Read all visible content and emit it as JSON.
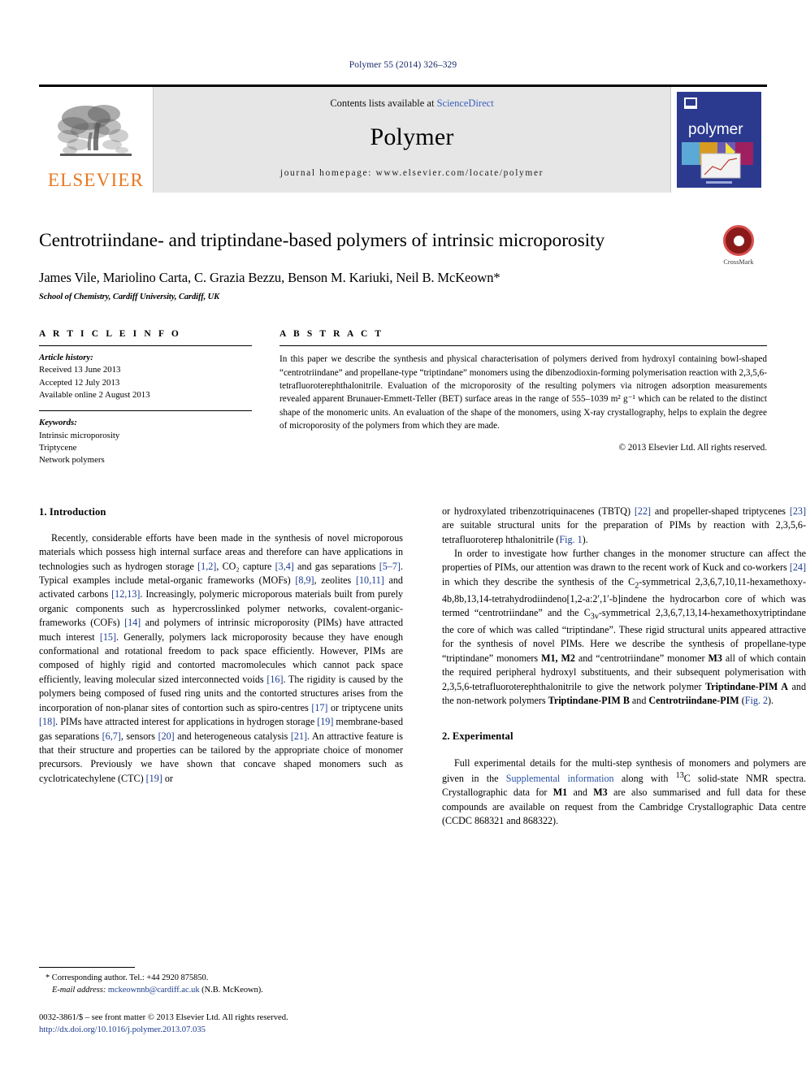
{
  "running_head": "Polymer 55 (2014) 326–329",
  "masthead": {
    "publisher_name": "ELSEVIER",
    "contents_prefix": "Contents lists available at ",
    "contents_link": "ScienceDirect",
    "journal_title": "Polymer",
    "homepage": "journal homepage: www.elsevier.com/locate/polymer",
    "cover_title": "polymer"
  },
  "article": {
    "title": "Centrotriindane- and triptindane-based polymers of intrinsic microporosity",
    "authors": "James Vile, Mariolino Carta, C. Grazia Bezzu, Benson M. Kariuki, Neil B. McKeown*",
    "affiliation": "School of Chemistry, Cardiff University, Cardiff, UK",
    "crossmark_label": "CrossMark"
  },
  "article_info": {
    "heading": "A R T I C L E    I N F O",
    "history_label": "Article history:",
    "history": [
      "Received 13 June 2013",
      "Accepted 12 July 2013",
      "Available online 2 August 2013"
    ],
    "keywords_label": "Keywords:",
    "keywords": [
      "Intrinsic microporosity",
      "Triptycene",
      "Network polymers"
    ]
  },
  "abstract": {
    "heading": "A B S T R A C T",
    "text": "In this paper we describe the synthesis and physical characterisation of polymers derived from hydroxyl containing bowl-shaped “centrotriindane” and propellane-type “triptindane” monomers using the dibenzodioxin-forming polymerisation reaction with 2,3,5,6-tetrafluoroterephthalonitrile. Evaluation of the microporosity of the resulting polymers via nitrogen adsorption measurements revealed apparent Brunauer-Emmett-Teller (BET) surface areas in the range of 555–1039 m² g⁻¹ which can be related to the distinct shape of the monomeric units. An evaluation of the shape of the monomers, using X-ray crystallography, helps to explain the degree of microporosity of the polymers from which they are made.",
    "copyright": "© 2013 Elsevier Ltd. All rights reserved."
  },
  "sections": {
    "introduction_heading": "1.  Introduction",
    "experimental_heading": "2.  Experimental"
  },
  "body": {
    "intro_p1_a": "Recently, considerable efforts have been made in the synthesis of novel microporous materials which possess high internal surface areas and therefore can have applications in technologies such as hydrogen storage ",
    "ref_1_2": "[1,2]",
    "intro_p1_b": ", CO₂ capture ",
    "ref_3_4": "[3,4]",
    "intro_p1_c": " and gas separations ",
    "ref_5_7": "[5–7]",
    "intro_p1_d": ". Typical examples include metal-organic frameworks (MOFs) ",
    "ref_8_9": "[8,9]",
    "intro_p1_e": ", zeolites ",
    "ref_10_11": "[10,11]",
    "intro_p1_f": " and activated carbons ",
    "ref_12_13": "[12,13]",
    "intro_p1_g": ". Increasingly, polymeric microporous materials built from purely organic components such as hypercrosslinked polymer networks, covalent-organic-frameworks (COFs) ",
    "ref_14": "[14]",
    "intro_p1_h": " and polymers of intrinsic microporosity (PIMs) have attracted much interest ",
    "ref_15": "[15]",
    "intro_p1_i": ". Generally, polymers lack microporosity because they have enough conformational and rotational freedom to pack space efficiently. However, PIMs are composed of highly rigid and contorted macromolecules which cannot pack space efficiently, leaving molecular sized interconnected voids ",
    "ref_16": "[16]",
    "intro_p1_j": ". The rigidity is caused by the polymers being composed of fused ring units and the contorted structures arises from the incorporation of non-planar sites of contortion such as spiro-centres ",
    "ref_17": "[17]",
    "intro_p1_k": " or triptycene units ",
    "ref_18": "[18]",
    "intro_p1_l": ". PIMs have attracted interest for applications in hydrogen storage ",
    "ref_19": "[19]",
    "intro_p1_m": " membrane-based gas separations ",
    "ref_6_7": "[6,7]",
    "intro_p1_n": ", sensors ",
    "ref_20": "[20]",
    "intro_p1_o": " and heterogeneous catalysis ",
    "ref_21": "[21]",
    "intro_p1_p": ". An attractive feature is that their structure and properties can be tailored by the appropriate choice of monomer precursors. Previously we have shown that concave shaped monomers such as cyclotricatechylene (CTC) ",
    "ref_19b": "[19]",
    "intro_p1_q": " or hydroxylated tribenzotriquinacenes (TBTQ) ",
    "ref_22": "[22]",
    "intro_p1_r": " and propeller-shaped triptycenes ",
    "ref_23": "[23]",
    "intro_p1_s": " are suitable structural units for the preparation of PIMs by reaction with 2,3,5,6-tetrafluoroterep hthalonitrile (",
    "fig1": "Fig. 1",
    "intro_p1_t": ").",
    "intro_p2_a": "In order to investigate how further changes in the monomer structure can affect the properties of PIMs, our attention was drawn to the recent work of Kuck and co-workers ",
    "ref_24": "[24]",
    "intro_p2_b": " in which they describe the synthesis of the C",
    "sub_2": "2",
    "intro_p2_c": "-symmetrical 2,3,6,7,10,11-hexamethoxy-4b,8b,13,14-tetrahydrodiindeno[1,2-a:2′,1′-b]indene the hydrocarbon core of which was termed “centrotriindane” and the C",
    "sub_3v": "3v",
    "intro_p2_d": "-symmetrical 2,3,6,7,13,14-hexamethoxytriptindane the core of which was called “triptindane”. These rigid structural units appeared attractive for the synthesis of novel PIMs. Here we describe the synthesis of propellane-type “triptindane” monomers ",
    "bold_m1m2": "M1, M2",
    "intro_p2_e": " and “centrotriindane” monomer ",
    "bold_m3": "M3",
    "intro_p2_f": " all of which contain the required peripheral hydroxyl substituents, and their subsequent polymerisation with 2,3,5,6-tetrafluoroterephthalonitrile to give the network polymer ",
    "bold_tpimA": "Triptindane-PIM A",
    "intro_p2_g": " and the non-network polymers ",
    "bold_tpimB": "Triptindane-PIM B",
    "intro_p2_h": " and ",
    "bold_cpim": "Centrotriindane-PIM",
    "intro_p2_i": " (",
    "fig2": "Fig. 2",
    "intro_p2_j": ").",
    "exp_p1_a": "Full experimental details for the multi-step synthesis of monomers and polymers are given in the ",
    "suppl_link": "Supplemental information",
    "exp_p1_b": " along with ",
    "sup_13": "13",
    "exp_p1_c": "C solid-state NMR spectra. Crystallographic data for ",
    "bold_m1": "M1",
    "exp_p1_d": " and ",
    "bold_m3b": "M3",
    "exp_p1_e": " are also summarised and full data for these compounds are available on request from the Cambridge Crystallographic Data centre (CCDC 868321 and 868322)."
  },
  "footnotes": {
    "corresponding": "* Corresponding author. Tel.: +44 2920 875850.",
    "email_label": "E-mail address:",
    "email_address": "mckeownnb@cardiff.ac.uk",
    "email_owner": "(N.B. McKeown).",
    "issn_line": "0032-3861/$ – see front matter © 2013 Elsevier Ltd. All rights reserved.",
    "doi": "http://dx.doi.org/10.1016/j.polymer.2013.07.035"
  },
  "colors": {
    "link_blue": "#2952a3",
    "ref_blue": "#1d3c8f",
    "elsevier_orange": "#E87722",
    "cover_blue": "#2b3a8f",
    "crossmark_red": "#8a1a1a"
  }
}
